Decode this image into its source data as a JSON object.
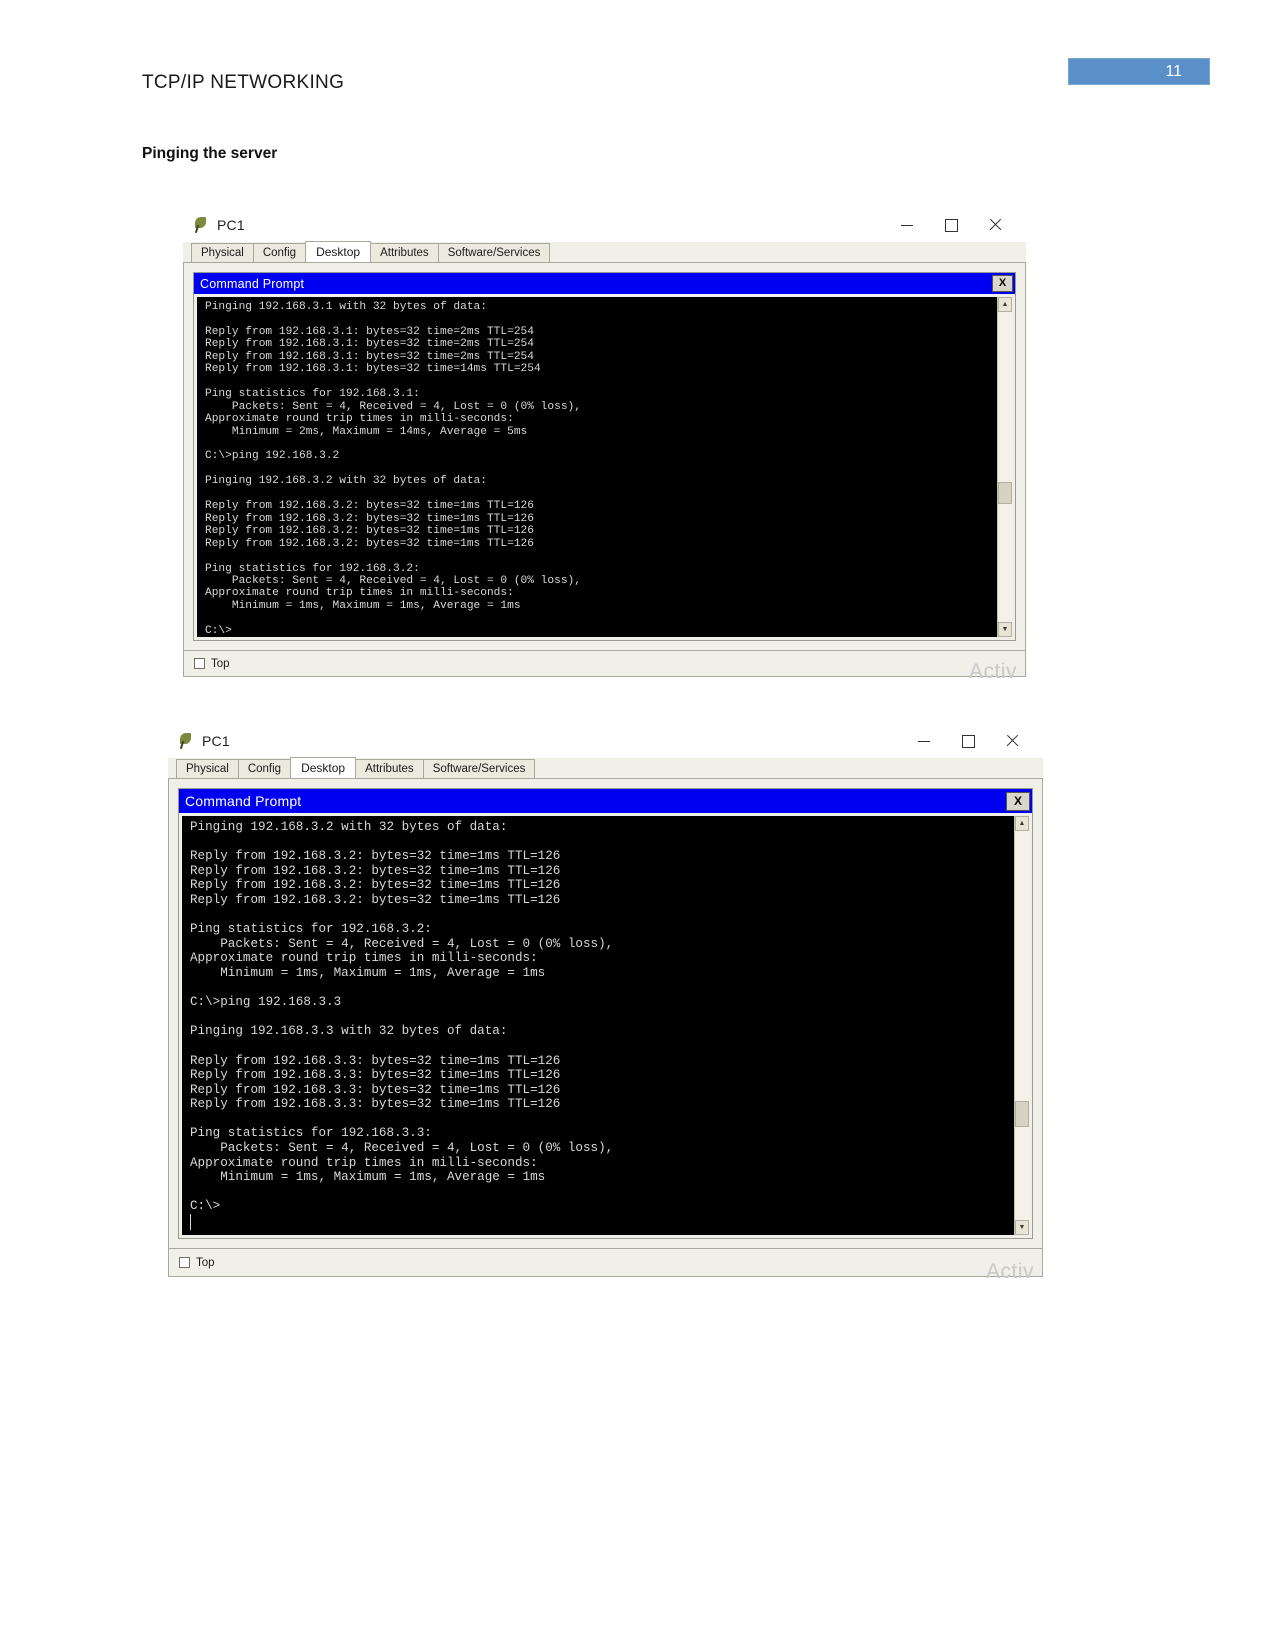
{
  "document": {
    "running_head": "TCP/IP NETWORKING",
    "page_number": "11",
    "section_heading": "Pinging the server",
    "accent_color": "#5b8fc7"
  },
  "windows": [
    {
      "title": "PC1",
      "icon": "packet-tracer-pc-icon",
      "controls": {
        "minimize": "–",
        "maximize": "□",
        "close": "✕"
      },
      "tabs": [
        {
          "label": "Physical",
          "active": false
        },
        {
          "label": "Config",
          "active": false
        },
        {
          "label": "Desktop",
          "active": true
        },
        {
          "label": "Attributes",
          "active": false
        },
        {
          "label": "Software/Services",
          "active": false
        }
      ],
      "command_prompt": {
        "title": "Command Prompt",
        "close_label": "X",
        "terminal_text": "Pinging 192.168.3.1 with 32 bytes of data:\n\nReply from 192.168.3.1: bytes=32 time=2ms TTL=254\nReply from 192.168.3.1: bytes=32 time=2ms TTL=254\nReply from 192.168.3.1: bytes=32 time=2ms TTL=254\nReply from 192.168.3.1: bytes=32 time=14ms TTL=254\n\nPing statistics for 192.168.3.1:\n    Packets: Sent = 4, Received = 4, Lost = 0 (0% loss),\nApproximate round trip times in milli-seconds:\n    Minimum = 2ms, Maximum = 14ms, Average = 5ms\n\nC:\\>ping 192.168.3.2\n\nPinging 192.168.3.2 with 32 bytes of data:\n\nReply from 192.168.3.2: bytes=32 time=1ms TTL=126\nReply from 192.168.3.2: bytes=32 time=1ms TTL=126\nReply from 192.168.3.2: bytes=32 time=1ms TTL=126\nReply from 192.168.3.2: bytes=32 time=1ms TTL=126\n\nPing statistics for 192.168.3.2:\n    Packets: Sent = 4, Received = 4, Lost = 0 (0% loss),\nApproximate round trip times in milli-seconds:\n    Minimum = 1ms, Maximum = 1ms, Average = 1ms\n\nC:\\>",
        "scrollbar": {
          "up_arrow": "▲",
          "down_arrow": "▼"
        }
      },
      "footer": {
        "top_checkbox_label": "Top",
        "top_checked": false,
        "watermark": "Activ"
      }
    },
    {
      "title": "PC1",
      "icon": "packet-tracer-pc-icon",
      "controls": {
        "minimize": "–",
        "maximize": "□",
        "close": "✕"
      },
      "tabs": [
        {
          "label": "Physical",
          "active": false
        },
        {
          "label": "Config",
          "active": false
        },
        {
          "label": "Desktop",
          "active": true
        },
        {
          "label": "Attributes",
          "active": false
        },
        {
          "label": "Software/Services",
          "active": false
        }
      ],
      "command_prompt": {
        "title": "Command Prompt",
        "close_label": "X",
        "terminal_text": "Pinging 192.168.3.2 with 32 bytes of data:\n\nReply from 192.168.3.2: bytes=32 time=1ms TTL=126\nReply from 192.168.3.2: bytes=32 time=1ms TTL=126\nReply from 192.168.3.2: bytes=32 time=1ms TTL=126\nReply from 192.168.3.2: bytes=32 time=1ms TTL=126\n\nPing statistics for 192.168.3.2:\n    Packets: Sent = 4, Received = 4, Lost = 0 (0% loss),\nApproximate round trip times in milli-seconds:\n    Minimum = 1ms, Maximum = 1ms, Average = 1ms\n\nC:\\>ping 192.168.3.3\n\nPinging 192.168.3.3 with 32 bytes of data:\n\nReply from 192.168.3.3: bytes=32 time=1ms TTL=126\nReply from 192.168.3.3: bytes=32 time=1ms TTL=126\nReply from 192.168.3.3: bytes=32 time=1ms TTL=126\nReply from 192.168.3.3: bytes=32 time=1ms TTL=126\n\nPing statistics for 192.168.3.3:\n    Packets: Sent = 4, Received = 4, Lost = 0 (0% loss),\nApproximate round trip times in milli-seconds:\n    Minimum = 1ms, Maximum = 1ms, Average = 1ms\n\nC:\\>",
        "scrollbar": {
          "up_arrow": "▲",
          "down_arrow": "▼"
        }
      },
      "footer": {
        "top_checkbox_label": "Top",
        "top_checked": false,
        "watermark": "Activ"
      }
    }
  ]
}
